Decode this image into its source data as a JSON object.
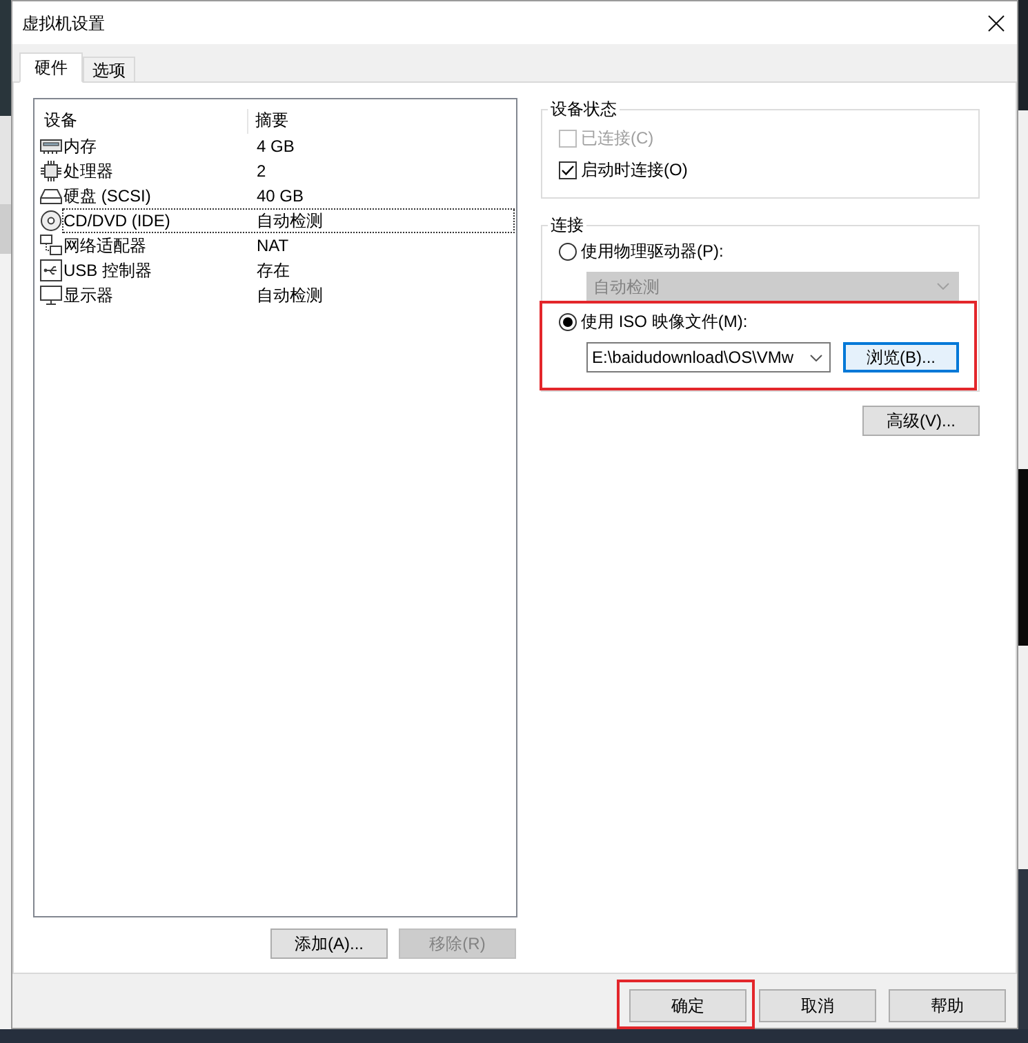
{
  "window": {
    "title": "虚拟机设置"
  },
  "tabs": [
    {
      "label": "硬件",
      "selected": true
    },
    {
      "label": "选项",
      "selected": false
    }
  ],
  "device_list": {
    "columns": [
      "设备",
      "摘要"
    ],
    "rows": [
      {
        "kind": "memory",
        "device": "内存",
        "summary": "4 GB",
        "selected": false
      },
      {
        "kind": "cpu",
        "device": "处理器",
        "summary": "2",
        "selected": false
      },
      {
        "kind": "disk",
        "device": "硬盘 (SCSI)",
        "summary": "40 GB",
        "selected": false
      },
      {
        "kind": "cd",
        "device": "CD/DVD (IDE)",
        "summary": "自动检测",
        "selected": true
      },
      {
        "kind": "network",
        "device": "网络适配器",
        "summary": "NAT",
        "selected": false
      },
      {
        "kind": "usb",
        "device": "USB 控制器",
        "summary": "存在",
        "selected": false
      },
      {
        "kind": "display",
        "device": "显示器",
        "summary": "自动检测",
        "selected": false
      }
    ]
  },
  "list_buttons": [
    {
      "label": "添加(A)...",
      "disabled": false
    },
    {
      "label": "移除(R)",
      "disabled": true
    }
  ],
  "device_status": {
    "title": "设备状态",
    "options": [
      {
        "label": "已连接(C)",
        "checked": false,
        "disabled": true
      },
      {
        "label": "启动时连接(O)",
        "checked": true,
        "disabled": false
      }
    ]
  },
  "connection": {
    "title": "连接",
    "options": [
      {
        "kind": "drive",
        "label": "使用物理驱动器(P):",
        "selected": false,
        "highlighted": false,
        "dropdown": {
          "value": "自动检测",
          "disabled": true
        }
      },
      {
        "kind": "iso",
        "label": "使用 ISO 映像文件(M):",
        "selected": true,
        "highlighted": true,
        "path": "E:\\baidudownload\\OS\\VMw",
        "browse": {
          "label": "浏览(B)...",
          "focused": true
        }
      }
    ],
    "advanced_button": "高级(V)..."
  },
  "footer_buttons": [
    {
      "label": "确定",
      "highlighted": true
    },
    {
      "label": "取消",
      "highlighted": false
    },
    {
      "label": "帮助",
      "highlighted": false
    }
  ]
}
